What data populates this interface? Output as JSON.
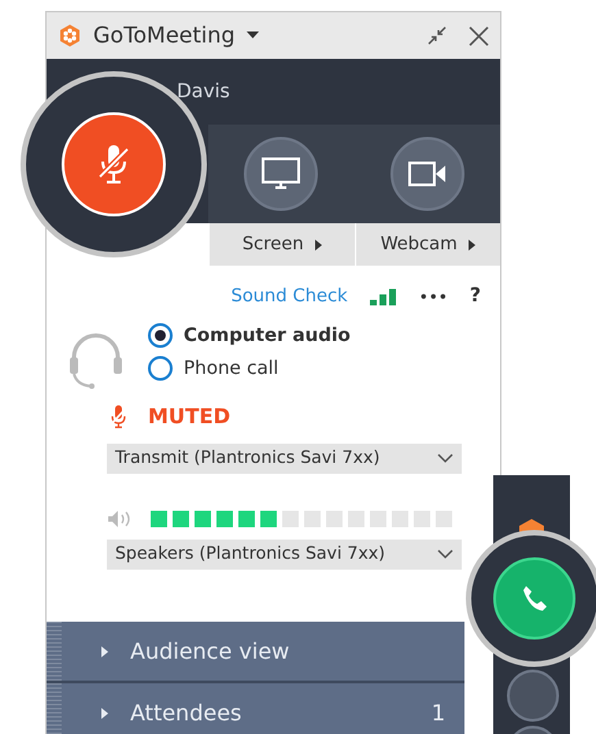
{
  "window": {
    "title": "GoToMeeting"
  },
  "header": {
    "name": "Davis"
  },
  "controls": [
    {
      "kind": "mic",
      "muted": true
    },
    {
      "kind": "screen"
    },
    {
      "kind": "webcam"
    }
  ],
  "tabs": [
    {
      "label": "Screen"
    },
    {
      "label": "Webcam"
    }
  ],
  "audio": {
    "sound_check": "Sound Check",
    "more": "•••",
    "help": "?",
    "options": [
      {
        "label": "Computer audio",
        "selected": true
      },
      {
        "label": "Phone call",
        "selected": false
      }
    ],
    "mic_status": "MUTED",
    "microphone": "Transmit (Plantronics Savi 7xx)",
    "speaker_meter": {
      "level": 0.43
    },
    "speakers": "Speakers (Plantronics Savi 7xx)"
  },
  "panels": [
    {
      "label": "Audience view"
    },
    {
      "label": "Attendees",
      "count": "1"
    }
  ]
}
